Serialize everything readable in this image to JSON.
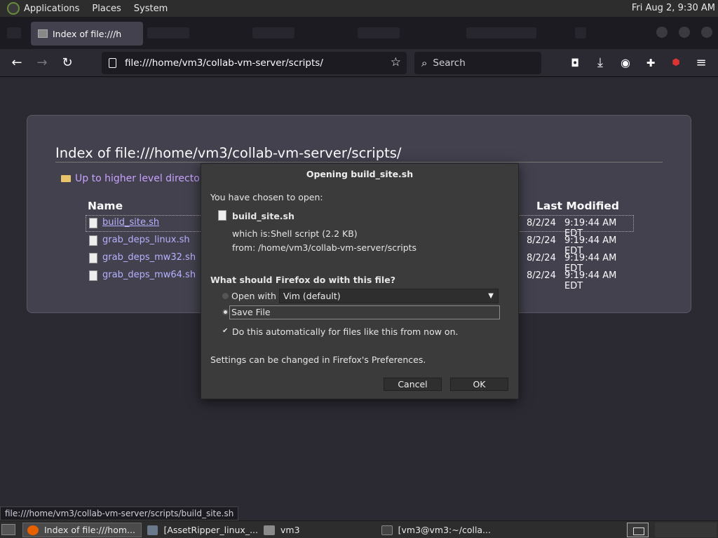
{
  "top_panel": {
    "menus": [
      "Applications",
      "Places",
      "System"
    ],
    "clock": "Fri Aug  2,  9:30 AM"
  },
  "browser": {
    "active_tab_title": "Index of file:///h",
    "url": "file:///home/vm3/collab-vm-server/scripts/",
    "search_placeholder": "Search"
  },
  "listing": {
    "heading": "Index of file:///home/vm3/collab-vm-server/scripts/",
    "up_link": "Up to higher level directory",
    "col_name": "Name",
    "col_modified": "Last Modified",
    "files": [
      {
        "name": "build_site.sh",
        "date": "8/2/24",
        "time": "9:19:44 AM EDT"
      },
      {
        "name": "grab_deps_linux.sh",
        "date": "8/2/24",
        "time": "9:19:44 AM EDT"
      },
      {
        "name": "grab_deps_mw32.sh",
        "date": "8/2/24",
        "time": "9:19:44 AM EDT"
      },
      {
        "name": "grab_deps_mw64.sh",
        "date": "8/2/24",
        "time": "9:19:44 AM EDT"
      }
    ]
  },
  "dialog": {
    "title": "Opening build_site.sh",
    "intro": "You have chosen to open:",
    "filename": "build_site.sh",
    "which_is_label": "which is:",
    "which_is_value": "Shell script (2.2 KB)",
    "from_label": "from:",
    "from_value": "/home/vm3/collab-vm-server/scripts",
    "question": "What should Firefox do with this file?",
    "open_with_label": "Open with",
    "open_with_value": "Vim (default)",
    "save_file_label": "Save File",
    "auto_label": "Do this automatically for files like this from now on.",
    "settings_note": "Settings can be changed in Firefox's Preferences.",
    "cancel_label": "Cancel",
    "ok_label": "OK"
  },
  "status_url": "file:///home/vm3/collab-vm-server/scripts/build_site.sh",
  "taskbar": {
    "tasks": [
      "Index of file:///hom...",
      "[AssetRipper_linux_...",
      "vm3",
      "[vm3@vm3:~/colla..."
    ]
  },
  "colors": {
    "link": "#b7b1ff",
    "visited_up": "#c8a2ff",
    "page_bg": "#2b2a33",
    "panel_bg": "#2d2d2d"
  }
}
